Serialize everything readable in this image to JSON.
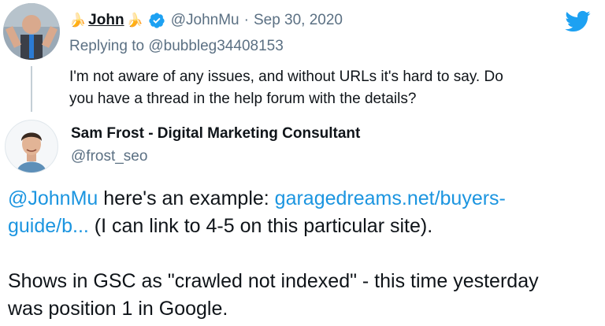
{
  "tweet": {
    "author": {
      "name": "John",
      "emoji_left": "🍌",
      "emoji_right": "🍌",
      "handle": "@JohnMu",
      "separator": "·",
      "date": "Sep 30, 2020",
      "verified_icon": "verified-badge-icon"
    },
    "replying_to": "Replying to @bubbleg34408153",
    "text_line1": "I'm not aware of any issues, and without URLs it's hard to say. Do",
    "text_line2": "you have a thread in the help forum with the details?",
    "brand_icon": "twitter-bird-icon"
  },
  "reply": {
    "author": {
      "name": "Sam Frost - Digital Marketing Consultant",
      "handle": "@frost_seo"
    },
    "mention": "@JohnMu",
    "text_part1": " here's an example: ",
    "link_part1": "garagedreams.net/buyers-",
    "link_part2": "guide/b...",
    "text_part2": " (I can link to 4-5 on this particular site).",
    "text_line3": "Shows in GSC as \"crawled not indexed\" - this time yesterday",
    "text_line4": "was position 1 in Google."
  },
  "colors": {
    "link": "#1b95e0",
    "secondary_text": "#5b7083",
    "twitter_blue": "#1da1f2",
    "thread_line": "#c4cfd6"
  }
}
